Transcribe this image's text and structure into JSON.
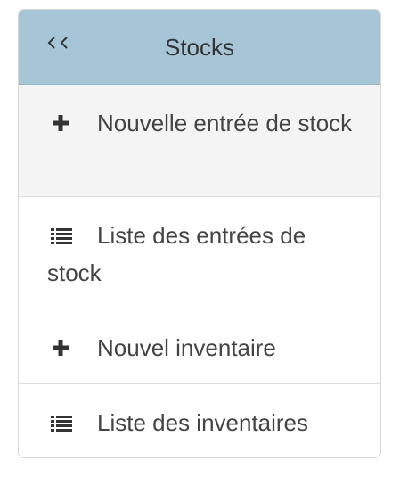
{
  "panel": {
    "title": "Stocks",
    "back_glyph": "< <"
  },
  "menu": [
    {
      "label": "Nouvelle entrée de stock",
      "icon": "plus-icon",
      "active": true
    },
    {
      "label": "Liste des entrées de stock",
      "icon": "list-icon",
      "active": false
    },
    {
      "label": "Nouvel inventaire",
      "icon": "plus-icon",
      "active": false
    },
    {
      "label": "Liste des inventaires",
      "icon": "list-icon",
      "active": false
    }
  ],
  "colors": {
    "header_background": "#a6c6d8",
    "active_item_background": "#f4f4f4",
    "text": "#444444",
    "border": "#dddddd"
  }
}
